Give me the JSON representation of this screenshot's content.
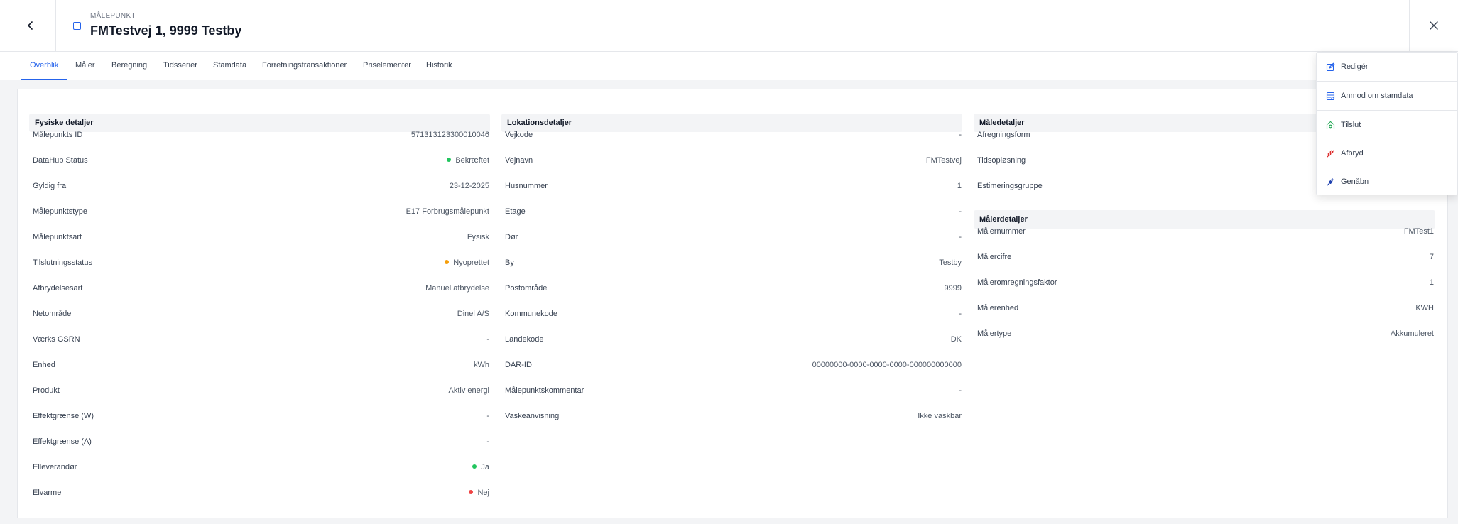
{
  "header": {
    "subtitle": "MÅLEPUNKT",
    "title": "FMTestvej 1, 9999 Testby"
  },
  "tabs": [
    "Overblik",
    "Måler",
    "Beregning",
    "Tidsserier",
    "Stamdata",
    "Forretningstransaktioner",
    "Priselementer",
    "Historik"
  ],
  "colors": {
    "accent": "#2563eb",
    "green": "#22c55e",
    "orange": "#f59e0b",
    "red": "#ef4444"
  },
  "physical": {
    "title": "Fysiske detaljer",
    "rows": [
      {
        "label": "Målepunkts ID",
        "value": "571313123300010046"
      },
      {
        "label": "DataHub Status",
        "value": "Bekræftet"
      },
      {
        "label": "Gyldig fra",
        "value": "23-12-2025"
      },
      {
        "label": "Målepunktstype",
        "value": "E17 Forbrugsmålepunkt"
      },
      {
        "label": "Målepunktsart",
        "value": "Fysisk"
      },
      {
        "label": "Tilslutningsstatus",
        "value": "Nyoprettet"
      },
      {
        "label": "Afbrydelsesart",
        "value": "Manuel afbrydelse"
      },
      {
        "label": "Netområde",
        "value": "Dinel A/S"
      },
      {
        "label": "Værks GSRN",
        "value": "-"
      },
      {
        "label": "Enhed",
        "value": "kWh"
      },
      {
        "label": "Produkt",
        "value": "Aktiv energi"
      },
      {
        "label": "Effektgrænse (W)",
        "value": "-"
      },
      {
        "label": "Effektgrænse (A)",
        "value": "-"
      },
      {
        "label": "Elleverandør",
        "value": "Ja"
      },
      {
        "label": "Elvarme",
        "value": "Nej"
      }
    ]
  },
  "location": {
    "title": "Lokationsdetaljer",
    "rows": [
      {
        "label": "Vejkode",
        "value": "-"
      },
      {
        "label": "Vejnavn",
        "value": "FMTestvej"
      },
      {
        "label": "Husnummer",
        "value": "1"
      },
      {
        "label": "Etage",
        "value": "-"
      },
      {
        "label": "Dør",
        "value": "-"
      },
      {
        "label": "By",
        "value": "Testby"
      },
      {
        "label": "Postområde",
        "value": "9999"
      },
      {
        "label": "Kommunekode",
        "value": "-"
      },
      {
        "label": "Landekode",
        "value": "DK"
      },
      {
        "label": "DAR-ID",
        "value": "00000000-0000-0000-0000-000000000000"
      },
      {
        "label": "Målepunktskommentar",
        "value": "-"
      },
      {
        "label": "Vaskeanvisning",
        "value": "Ikke vaskbar"
      }
    ]
  },
  "measure": {
    "title": "Måledetaljer",
    "rows": [
      {
        "label": "Afregningsform"
      },
      {
        "label": "Tidsopløsning"
      },
      {
        "label": "Estimeringsgruppe"
      }
    ]
  },
  "meter": {
    "title": "Målerdetaljer",
    "rows": [
      {
        "label": "Målernummer",
        "value": "FMTest1"
      },
      {
        "label": "Målercifre",
        "value": "7"
      },
      {
        "label": "Måleromregningsfaktor",
        "value": "1"
      },
      {
        "label": "Målerenhed",
        "value": "KWH"
      },
      {
        "label": "Målertype",
        "value": "Akkumuleret"
      }
    ]
  },
  "menu": {
    "items": [
      "Redigér",
      "Anmod om stamdata",
      "Tilslut",
      "Afbryd",
      "Genåbn"
    ]
  }
}
